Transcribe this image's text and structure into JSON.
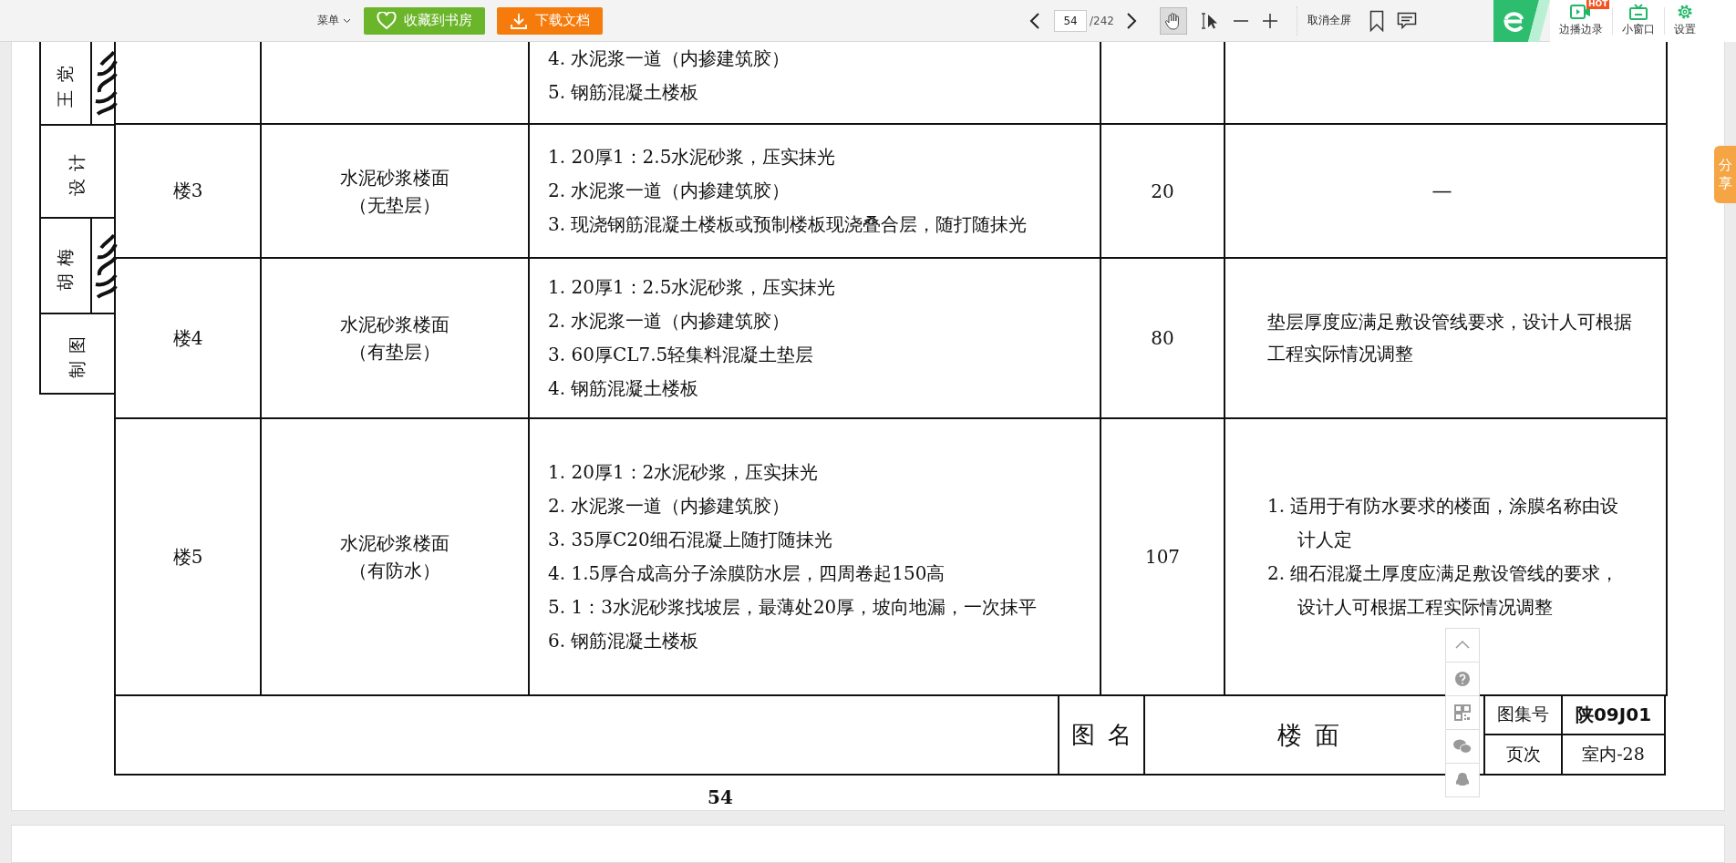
{
  "toolbar": {
    "menu": "菜单",
    "collect_button": "收藏到书房",
    "download_button": "下载文档",
    "page_input": "54",
    "page_total": "/242",
    "exit_fullscreen": "取消全屏",
    "record_button": "边播边录",
    "hot_badge": "HOT",
    "mini_window_button": "小窗口",
    "settings_button": "设置"
  },
  "stamp": [
    {
      "label": "王党",
      "signed": true
    },
    {
      "label": "设计",
      "signed": false
    },
    {
      "label": "胡梅",
      "signed": true
    },
    {
      "label": "制图",
      "signed": false
    }
  ],
  "table": {
    "rows": [
      {
        "layers": [
          "4. 水泥浆一道（内掺建筑胶）",
          "5. 钢筋混凝土楼板"
        ]
      },
      {
        "code": "楼3",
        "name": [
          "水泥砂浆楼面",
          "（无垫层）"
        ],
        "layers": [
          "1. 20厚1：2.5水泥砂浆，压实抹光",
          "2. 水泥浆一道（内掺建筑胶）",
          "3. 现浇钢筋混凝土楼板或预制楼板现浇叠合层，随打随抹光"
        ],
        "thickness": "20",
        "note": "—"
      },
      {
        "code": "楼4",
        "name": [
          "水泥砂浆楼面",
          "（有垫层）"
        ],
        "layers": [
          "1. 20厚1：2.5水泥砂浆，压实抹光",
          "2. 水泥浆一道（内掺建筑胶）",
          "3. 60厚CL7.5轻集料混凝土垫层",
          "4. 钢筋混凝土楼板"
        ],
        "thickness": "80",
        "note": "垫层厚度应满足敷设管线要求，设计人可根据工程实际情况调整"
      },
      {
        "code": "楼5",
        "name": [
          "水泥砂浆楼面",
          "（有防水）"
        ],
        "layers": [
          "1. 20厚1：2水泥砂浆，压实抹光",
          "2. 水泥浆一道（内掺建筑胶）",
          "3. 35厚C20细石混凝上随打随抹光",
          "4. 1.5厚合成高分子涂膜防水层，四周卷起150高",
          "5. 1：3水泥砂浆找坡层，最薄处20厚，坡向地漏，一次抹平",
          "6. 钢筋混凝土楼板"
        ],
        "thickness": "107",
        "notes": [
          "1. 适用于有防水要求的楼面，涂膜名称由设计人定",
          "2. 细石混凝土厚度应满足敷设管线的要求，设计人可根据工程实际情况调整"
        ]
      }
    ]
  },
  "title_block": {
    "label": "图名",
    "title": "楼面",
    "atlas_label": "图集号",
    "atlas_no": "陕09J01",
    "page_label": "页次",
    "page_no": "室内-28"
  },
  "page_number": "54",
  "share_tab": "分享"
}
